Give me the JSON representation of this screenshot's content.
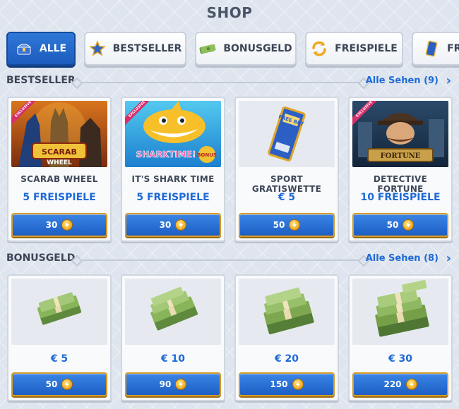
{
  "header": {
    "title": "SHOP"
  },
  "tabs": [
    {
      "label": "ALLE",
      "icon": "treasure-chest-icon",
      "active": true
    },
    {
      "label": "BESTSELLER",
      "icon": "star-icon",
      "active": false
    },
    {
      "label": "BONUSGELD",
      "icon": "cash-icon",
      "active": false
    },
    {
      "label": "FREISPIELE",
      "icon": "refresh-icon",
      "active": false
    },
    {
      "label": "FR",
      "icon": "ticket-icon",
      "active": false
    }
  ],
  "bestseller": {
    "title": "BESTSELLER",
    "see_all": "Alle Sehen (9)",
    "items": [
      {
        "name": "SCARAB WHEEL",
        "value": "5 FREISPIELE",
        "price": "30",
        "image": "scarab-wheel-game-art",
        "badge": "EXCLUSIVE"
      },
      {
        "name": "IT'S SHARK TIME",
        "value": "5 FREISPIELE",
        "price": "30",
        "image": "shark-time-game-art",
        "badge": "EXCLUSIVE"
      },
      {
        "name": "SPORT GRATISWETTE",
        "value": "€ 5",
        "price": "50",
        "image": "bet-ticket-art",
        "badge": ""
      },
      {
        "name": "DETECTIVE FORTUNE",
        "value": "10 FREISPIELE",
        "price": "50",
        "image": "detective-fortune-game-art",
        "badge": "EXCLUSIVE"
      }
    ]
  },
  "bonusgeld": {
    "title": "BONUSGELD",
    "see_all": "Alle Sehen (8)",
    "items": [
      {
        "value": "€ 5",
        "price": "50",
        "image": "money-stack-small"
      },
      {
        "value": "€ 10",
        "price": "90",
        "image": "money-stack-medium"
      },
      {
        "value": "€ 20",
        "price": "150",
        "image": "money-stack-large"
      },
      {
        "value": "€ 30",
        "price": "220",
        "image": "money-stack-xlarge"
      }
    ]
  },
  "colors": {
    "accent_blue": "#1e6ad6",
    "button_border_gold": "#d59b2a",
    "exclusive_badge": "#d62f6b"
  }
}
